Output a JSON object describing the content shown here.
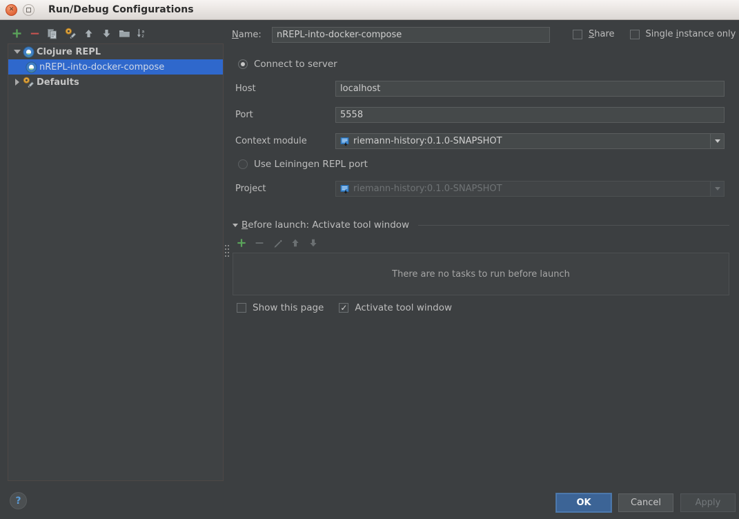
{
  "window": {
    "title": "Run/Debug Configurations",
    "close_icon": "close-icon",
    "maximize_icon": "maximize-icon"
  },
  "toolbar": {
    "items": [
      {
        "name": "add-configuration-button",
        "icon": "plus-icon",
        "tooltip": "Add New Configuration"
      },
      {
        "name": "remove-configuration-button",
        "icon": "minus-icon",
        "tooltip": "Remove Configuration"
      },
      {
        "name": "copy-configuration-button",
        "icon": "copy-icon",
        "tooltip": "Copy Configuration"
      },
      {
        "name": "edit-defaults-button",
        "icon": "wrench-gear-icon",
        "tooltip": "Edit defaults"
      },
      {
        "name": "move-up-button",
        "icon": "arrow-up-icon",
        "tooltip": "Move Up"
      },
      {
        "name": "move-down-button",
        "icon": "arrow-down-icon",
        "tooltip": "Move Down"
      },
      {
        "name": "create-folder-button",
        "icon": "folder-icon",
        "tooltip": "Create New Folder"
      },
      {
        "name": "sort-configurations-button",
        "icon": "sort-az-icon",
        "tooltip": "Sort Configurations"
      }
    ]
  },
  "tree": {
    "nodes": [
      {
        "label": "Clojure REPL",
        "icon": "clojure-repl-icon",
        "expanded": true,
        "selected": false,
        "level": 0
      },
      {
        "label": "nREPL-into-docker-compose",
        "icon": "clojure-repl-icon",
        "selected": true,
        "level": 1
      },
      {
        "label": "Defaults",
        "icon": "wrench-gear-icon",
        "expanded": false,
        "selected": false,
        "level": 0
      }
    ]
  },
  "form": {
    "name_label": "Name:",
    "name_mnemonic": "N",
    "name_label_rest": "ame:",
    "name_value": "nREPL-into-docker-compose",
    "share": {
      "label_mnemonic": "S",
      "label_rest": "hare",
      "label": "Share",
      "checked": false
    },
    "single_instance": {
      "label_pre": "Single ",
      "label_mnemonic": "i",
      "label_rest": "nstance only",
      "label": "Single instance only",
      "checked": false
    },
    "connect_to_server": {
      "label": "Connect to server",
      "selected": true
    },
    "host_label": "Host",
    "host_value": "localhost",
    "port_label": "Port",
    "port_value": "5558",
    "context_module_label": "Context module",
    "context_module_value": "riemann-history:0.1.0-SNAPSHOT",
    "context_module_icon": "module-icon",
    "use_leiningen": {
      "label": "Use Leiningen REPL port",
      "selected": false
    },
    "project_label": "Project",
    "project_value": "riemann-history:0.1.0-SNAPSHOT",
    "project_icon": "module-icon",
    "project_disabled": true
  },
  "before_launch": {
    "title": "Before launch: Activate tool window",
    "title_mnemonic": "B",
    "title_rest": "efore launch: Activate tool window",
    "expanded": true,
    "toolbar": [
      {
        "name": "add-task-button",
        "icon": "plus-icon",
        "enabled": true
      },
      {
        "name": "remove-task-button",
        "icon": "minus-icon",
        "enabled": false
      },
      {
        "name": "edit-task-button",
        "icon": "pencil-icon",
        "enabled": false
      },
      {
        "name": "move-task-up-button",
        "icon": "arrow-up-icon",
        "enabled": false
      },
      {
        "name": "move-task-down-button",
        "icon": "arrow-down-icon",
        "enabled": false
      }
    ],
    "empty_text": "There are no tasks to run before launch",
    "show_this_page": {
      "label": "Show this page",
      "checked": false
    },
    "activate_tool_window": {
      "label": "Activate tool window",
      "checked": true
    }
  },
  "footer": {
    "help_label": "?",
    "ok_label": "OK",
    "cancel_label": "Cancel",
    "apply_label": "Apply",
    "apply_enabled": false
  },
  "colors": {
    "background": "#3c3f41",
    "selection": "#2f68cc",
    "input_background": "#45494a",
    "accent_primary": "#3c6496",
    "add_green": "#5aa35a",
    "remove_red": "#c75450",
    "help_blue": "#5b9bd5"
  }
}
